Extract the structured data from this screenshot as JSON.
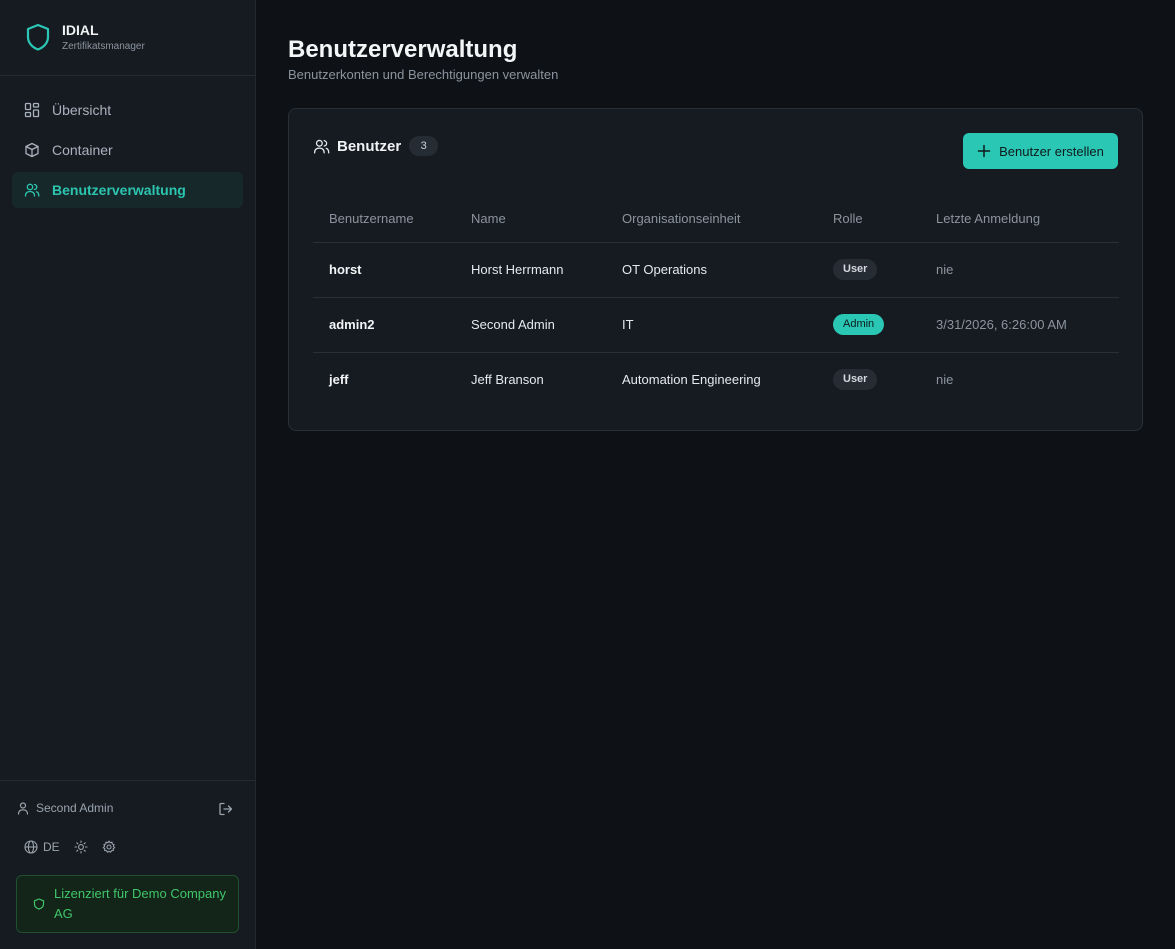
{
  "brand": {
    "title": "IDIAL",
    "subtitle": "Zertifikatsmanager"
  },
  "nav": [
    {
      "label": "Übersicht",
      "icon": "dashboard-icon",
      "active": false
    },
    {
      "label": "Container",
      "icon": "box-icon",
      "active": false
    },
    {
      "label": "Benutzerverwaltung",
      "icon": "users-icon",
      "active": true
    }
  ],
  "sidebar_footer": {
    "user_name": "Second Admin",
    "language": "DE",
    "license": "Lizenziert für Demo Company AG"
  },
  "page": {
    "title": "Benutzerverwaltung",
    "subtitle": "Benutzerkonten und Berechtigungen verwalten"
  },
  "users_card": {
    "title": "Benutzer",
    "count": "3",
    "create_button": "Benutzer erstellen",
    "columns": [
      "Benutzername",
      "Name",
      "Organisationseinheit",
      "Rolle",
      "Letzte Anmeldung"
    ],
    "rows": [
      {
        "username": "horst",
        "name": "Horst Herrmann",
        "org_unit": "OT Operations",
        "role": "User",
        "last_login": "nie"
      },
      {
        "username": "admin2",
        "name": "Second Admin",
        "org_unit": "IT",
        "role": "Admin",
        "last_login": "3/31/2026, 6:26:00 AM"
      },
      {
        "username": "jeff",
        "name": "Jeff Branson",
        "org_unit": "Automation Engineering",
        "role": "User",
        "last_login": "nie"
      }
    ]
  },
  "colors": {
    "accent": "#2ac7b4",
    "license_green": "#3fc66a",
    "background": "#0e1116",
    "sidebar": "#161b22"
  }
}
